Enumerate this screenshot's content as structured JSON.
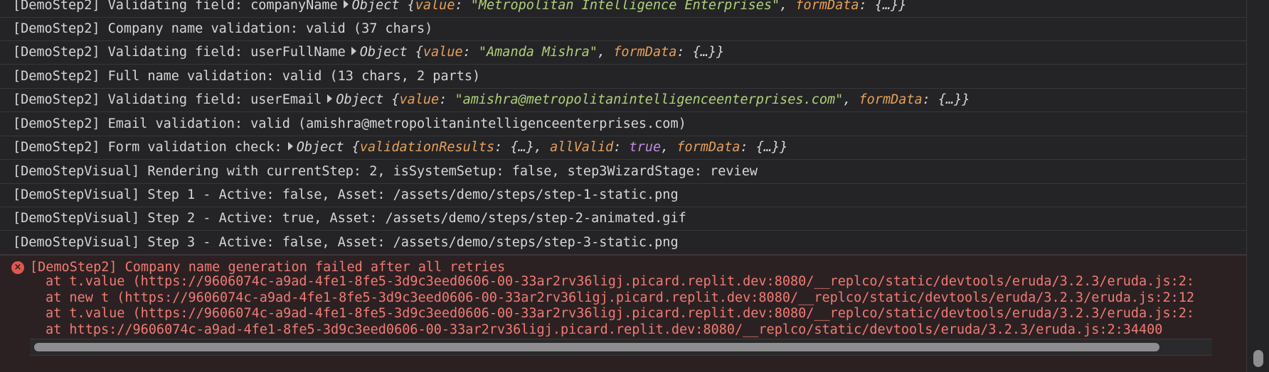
{
  "logs": [
    {
      "text": "[DemoStep2] Validating field: companyName",
      "obj": {
        "label": "Object",
        "pairs": [
          {
            "key": "value",
            "val": "\"Metropolitan Intelligence Enterprises\"",
            "type": "str"
          },
          {
            "key": "formData",
            "val": "{…}",
            "type": "pun"
          }
        ]
      }
    },
    {
      "text": "[DemoStep2] Company name validation: valid (37 chars)"
    },
    {
      "text": "[DemoStep2] Validating field: userFullName",
      "obj": {
        "label": "Object",
        "pairs": [
          {
            "key": "value",
            "val": "\"Amanda Mishra\"",
            "type": "str"
          },
          {
            "key": "formData",
            "val": "{…}",
            "type": "pun"
          }
        ]
      }
    },
    {
      "text": "[DemoStep2] Full name validation: valid (13 chars, 2 parts)"
    },
    {
      "text": "[DemoStep2] Validating field: userEmail",
      "obj": {
        "label": "Object",
        "pairs": [
          {
            "key": "value",
            "val": "\"amishra@metropolitanintelligenceenterprises.com\"",
            "type": "str"
          },
          {
            "key": "formData",
            "val": "{…}",
            "type": "pun"
          }
        ]
      }
    },
    {
      "text": "[DemoStep2] Email validation: valid (amishra@metropolitanintelligenceenterprises.com)"
    },
    {
      "text": "[DemoStep2] Form validation check:",
      "obj": {
        "label": "Object",
        "pairs": [
          {
            "key": "validationResults",
            "val": "{…}",
            "type": "pun"
          },
          {
            "key": "allValid",
            "val": "true",
            "type": "bool"
          },
          {
            "key": "formData",
            "val": "{…}",
            "type": "pun"
          }
        ]
      }
    },
    {
      "text": "[DemoStepVisual] Rendering with currentStep: 2, isSystemSetup: false, step3WizardStage: review"
    },
    {
      "text": "[DemoStepVisual] Step 1 - Active: false, Asset: /assets/demo/steps/step-1-static.png"
    },
    {
      "text": "[DemoStepVisual] Step 2 - Active: true, Asset: /assets/demo/steps/step-2-animated.gif"
    },
    {
      "text": "[DemoStepVisual] Step 3 - Active: false, Asset: /assets/demo/steps/step-3-static.png"
    }
  ],
  "error": {
    "icon": "error-circle-icon",
    "icon_glyph": "×",
    "message": "[DemoStep2] Company name generation failed after all retries",
    "stack": [
      "at t.value (https://9606074c-a9ad-4fe1-8fe5-3d9c3eed0606-00-33ar2rv36ligj.picard.replit.dev:8080/__replco/static/devtools/eruda/3.2.3/eruda.js:2:",
      "at new t (https://9606074c-a9ad-4fe1-8fe5-3d9c3eed0606-00-33ar2rv36ligj.picard.replit.dev:8080/__replco/static/devtools/eruda/3.2.3/eruda.js:2:12",
      "at t.value (https://9606074c-a9ad-4fe1-8fe5-3d9c3eed0606-00-33ar2rv36ligj.picard.replit.dev:8080/__replco/static/devtools/eruda/3.2.3/eruda.js:2:",
      "at https://9606074c-a9ad-4fe1-8fe5-3d9c3eed0606-00-33ar2rv36ligj.picard.replit.dev:8080/__replco/static/devtools/eruda/3.2.3/eruda.js:2:34400"
    ]
  },
  "colors": {
    "background": "#242426",
    "text": "#d6d6d6",
    "key": "#e6a15a",
    "string": "#b1d07c",
    "boolean": "#c38dde",
    "error_text": "#f07b74",
    "error_background": "#2c2122"
  }
}
